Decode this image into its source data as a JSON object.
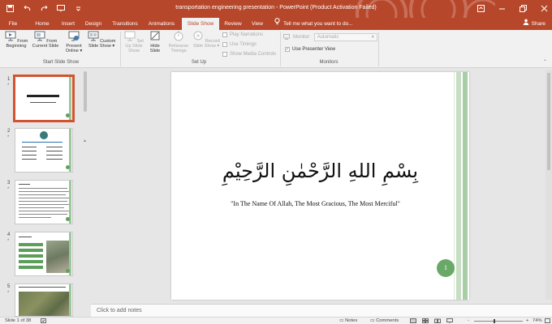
{
  "titlebar": {
    "title": "transportation engineering presentation - PowerPoint (Product Activation Failed)",
    "icons": [
      "save-icon",
      "undo-icon",
      "redo-icon",
      "present-icon",
      "customize-qat-icon"
    ],
    "controls": [
      "ribbon-options-icon",
      "minimize-icon",
      "restore-icon",
      "close-icon"
    ]
  },
  "tabs": [
    {
      "label": "File"
    },
    {
      "label": "Home"
    },
    {
      "label": "Insert"
    },
    {
      "label": "Design"
    },
    {
      "label": "Transitions"
    },
    {
      "label": "Animations"
    },
    {
      "label": "Slide Show",
      "active": true
    },
    {
      "label": "Review"
    },
    {
      "label": "View"
    }
  ],
  "tell_me": "Tell me what you want to do...",
  "share": "Share",
  "ribbon": {
    "start_slide_show": {
      "label": "Start Slide Show",
      "buttons": [
        "From Beginning",
        "From Current Slide",
        "Present Online",
        "Custom Slide Show"
      ],
      "dropdown_marker": "▾"
    },
    "set_up": {
      "label": "Set Up",
      "buttons": [
        "Set Up Slide Show",
        "Hide Slide",
        "Rehearse Timings",
        "Record Slide Show"
      ],
      "checkboxes": [
        {
          "label": "Play Narrations",
          "checked": false
        },
        {
          "label": "Use Timings",
          "checked": false
        },
        {
          "label": "Show Media Controls",
          "checked": false
        }
      ]
    },
    "monitors": {
      "label": "Monitors",
      "monitor_label": "Monitor:",
      "monitor_value": "Automatic",
      "presenter_view": {
        "label": "Use Presenter View",
        "checked": true
      }
    }
  },
  "thumbnails": [
    {
      "number": "1",
      "star": "*",
      "selected": true
    },
    {
      "number": "2",
      "star": "*",
      "selected": false
    },
    {
      "number": "3",
      "star": "*",
      "selected": false
    },
    {
      "number": "4",
      "star": "*",
      "selected": false
    },
    {
      "number": "5",
      "star": "*",
      "selected": false
    }
  ],
  "slide": {
    "arabic": "بِسْمِ اللهِ الرَّحْمٰنِ الرَّحِيْمِ",
    "tagline": "\"In The Name Of  Allah, The Most Gracious, The Most Merciful\"",
    "number": "1"
  },
  "notes_placeholder": "Click to add notes",
  "statusbar": {
    "slide_info": "Slide 1 of 38",
    "notes": "Notes",
    "comments": "Comments",
    "zoom_minus": "-",
    "zoom_plus": "+",
    "zoom": "74%"
  },
  "colors": {
    "accent": "#b7472a",
    "slide_green": "#6aa868",
    "selection": "#d35230"
  }
}
